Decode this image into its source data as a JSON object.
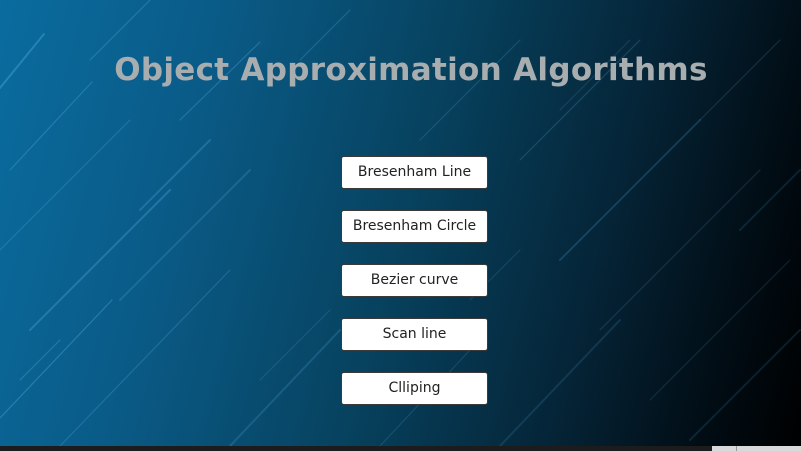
{
  "window": {
    "title": "Object Approximation Algorithms"
  },
  "menu": {
    "buttons": [
      {
        "label": "Bresenham Line"
      },
      {
        "label": "Bresenham Circle"
      },
      {
        "label": "Bezier curve"
      },
      {
        "label": "Scan line"
      },
      {
        "label": "Clliping"
      }
    ]
  },
  "colors": {
    "background_start": "#0a6c9f",
    "background_end": "#000000",
    "title_text": "#a8adb0",
    "button_bg": "#ffffff",
    "button_border": "#3a3a3a",
    "streak": "#5fb4e6"
  }
}
